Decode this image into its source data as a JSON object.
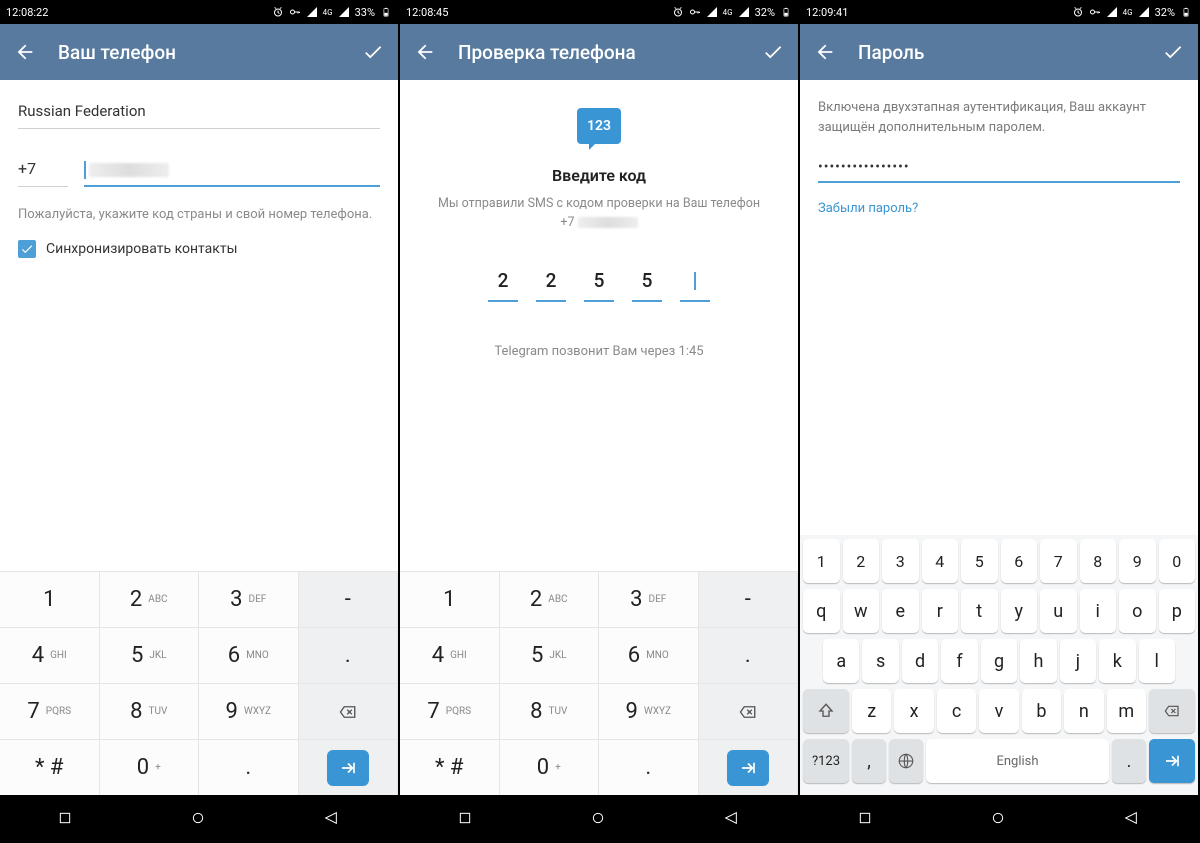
{
  "screens": [
    {
      "status": {
        "time": "12:08:22",
        "battery": "33%"
      },
      "title": "Ваш телефон",
      "country": "Russian Federation",
      "code": "+7",
      "hint": "Пожалуйста, укажите код страны и свой номер телефона.",
      "syncLabel": "Синхронизировать контакты"
    },
    {
      "status": {
        "time": "12:08:45",
        "battery": "32%"
      },
      "title": "Проверка телефона",
      "smsIcon": "123",
      "enterCode": "Введите код",
      "codeHint1": "Мы отправили SMS с кодом проверки на Ваш телефон",
      "codeHint2": "+7",
      "codes": [
        "2",
        "2",
        "5",
        "5",
        ""
      ],
      "callback": "Telegram позвонит Вам через 1:45"
    },
    {
      "status": {
        "time": "12:09:41",
        "battery": "32%"
      },
      "title": "Пароль",
      "pwHint": "Включена двухэтапная аутентификация, Ваш аккаунт защищён дополнительным паролем.",
      "pwDots": "••••••••••••••••",
      "forgot": "Забыли пароль?"
    }
  ],
  "numpad": [
    {
      "d": "1",
      "l": ""
    },
    {
      "d": "2",
      "l": "ABC"
    },
    {
      "d": "3",
      "l": "DEF"
    },
    {
      "d": "-",
      "l": "",
      "action": true
    },
    {
      "d": "4",
      "l": "GHI"
    },
    {
      "d": "5",
      "l": "JKL"
    },
    {
      "d": "6",
      "l": "MNO"
    },
    {
      "d": ".",
      "l": "",
      "action": true
    },
    {
      "d": "7",
      "l": "PQRS"
    },
    {
      "d": "8",
      "l": "TUV"
    },
    {
      "d": "9",
      "l": "WXYZ"
    },
    {
      "d": "bksp",
      "l": "",
      "action": true
    },
    {
      "d": "* #",
      "l": ""
    },
    {
      "d": "0",
      "l": "+"
    },
    {
      "d": ".",
      "l": ""
    },
    {
      "d": "go",
      "l": "",
      "action": true
    }
  ],
  "qwerty": {
    "numrow": [
      "1",
      "2",
      "3",
      "4",
      "5",
      "6",
      "7",
      "8",
      "9",
      "0"
    ],
    "row1": [
      "q",
      "w",
      "e",
      "r",
      "t",
      "y",
      "u",
      "i",
      "o",
      "p"
    ],
    "row2": [
      "a",
      "s",
      "d",
      "f",
      "g",
      "h",
      "j",
      "k",
      "l"
    ],
    "row3": [
      "z",
      "x",
      "c",
      "v",
      "b",
      "n",
      "m"
    ],
    "sym": "?123",
    "space": "English",
    "comma": ",",
    "period": "."
  }
}
